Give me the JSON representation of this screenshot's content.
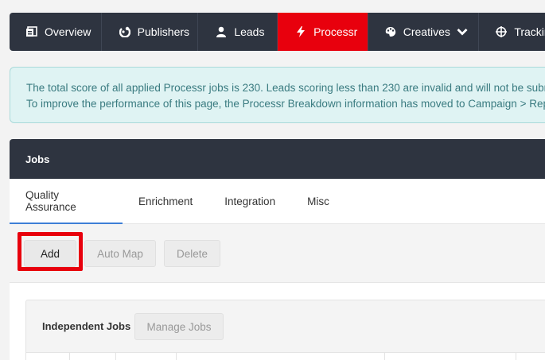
{
  "nav": {
    "items": [
      {
        "label": "Overview",
        "icon": "dashboard-icon"
      },
      {
        "label": "Publishers",
        "icon": "publishers-icon"
      },
      {
        "label": "Leads",
        "icon": "user-icon"
      },
      {
        "label": "Processr",
        "icon": "bolt-icon"
      },
      {
        "label": "Creatives",
        "icon": "palette-icon"
      },
      {
        "label": "Tracking",
        "icon": "crosshair-icon"
      }
    ],
    "active_color": "#e8000d"
  },
  "alert": {
    "line1": "The total score of all applied Processr jobs is 230. Leads scoring less than 230 are invalid and will not be submitted",
    "line2": "To improve the performance of this page, the Processr Breakdown information has moved to Campaign > Reports >"
  },
  "card": {
    "title": "Jobs",
    "tabs": [
      "Quality Assurance",
      "Enrichment",
      "Integration",
      "Misc"
    ],
    "toolbar": {
      "add": "Add",
      "auto_map": "Auto Map",
      "delete": "Delete"
    },
    "independent": {
      "title": "Independent Jobs",
      "manage": "Manage Jobs"
    }
  }
}
